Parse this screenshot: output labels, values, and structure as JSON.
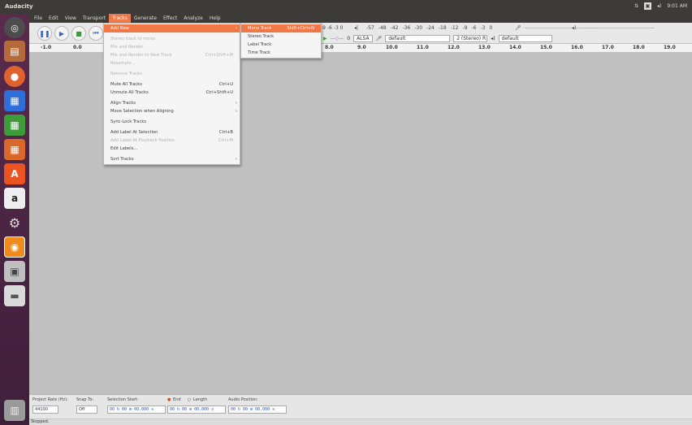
{
  "app": {
    "title": "Audacity"
  },
  "system": {
    "kbd": "⇅",
    "battery": "▣",
    "volume": "◂)",
    "clock": "9:01 AM"
  },
  "menubar": [
    "File",
    "Edit",
    "View",
    "Transport",
    "Tracks",
    "Generate",
    "Effect",
    "Analyze",
    "Help"
  ],
  "toolbar": {
    "meter_rec": "-9 -6 -3 0",
    "meter_ticks": [
      "-57",
      "-48",
      "-42",
      "-36",
      "-30",
      "-24",
      "-18",
      "-12",
      "-9",
      "-6",
      "-3",
      "0"
    ],
    "play_slider_label": "0",
    "host": "ALSA",
    "rec_device": "default",
    "channels": "2 (Stereo) R",
    "play_device": "default"
  },
  "ruler": [
    "-1.0",
    "0.0",
    "8.0",
    "9.0",
    "10.0",
    "11.0",
    "12.0",
    "13.0",
    "14.0",
    "15.0",
    "16.0",
    "17.0",
    "18.0",
    "19.0"
  ],
  "tracks_menu": [
    {
      "label": "Add New",
      "highlight": true,
      "submenu": true
    },
    {
      "sep": true
    },
    {
      "label": "Stereo track to mono",
      "disabled": true
    },
    {
      "label": "Mix and Render",
      "disabled": true
    },
    {
      "label": "Mix and Render to New Track",
      "shortcut": "Ctrl+Shift+M",
      "disabled": true
    },
    {
      "label": "Resample...",
      "disabled": true
    },
    {
      "sep": true
    },
    {
      "label": "Remove Tracks",
      "disabled": true
    },
    {
      "sep": true
    },
    {
      "label": "Mute All Tracks",
      "shortcut": "Ctrl+U"
    },
    {
      "label": "Unmute All Tracks",
      "shortcut": "Ctrl+Shift+U"
    },
    {
      "sep": true
    },
    {
      "label": "Align Tracks",
      "submenu": true
    },
    {
      "label": "Move Selection when Aligning",
      "submenu": true
    },
    {
      "sep": true
    },
    {
      "label": "Sync-Lock Tracks"
    },
    {
      "sep": true
    },
    {
      "label": "Add Label At Selection",
      "shortcut": "Ctrl+B"
    },
    {
      "label": "Add Label At Playback Position",
      "shortcut": "Ctrl+M",
      "disabled": true
    },
    {
      "label": "Edit Labels..."
    },
    {
      "sep": true
    },
    {
      "label": "Sort Tracks",
      "submenu": true
    }
  ],
  "add_new_submenu": [
    {
      "label": "Mono Track",
      "shortcut": "Shift+Ctrl+N",
      "highlight": true
    },
    {
      "label": "Stereo Track"
    },
    {
      "label": "Label Track"
    },
    {
      "label": "Time Track"
    }
  ],
  "bottom": {
    "rate_label": "Project Rate (Hz):",
    "rate_value": "44100",
    "snap_label": "Snap To:",
    "snap_value": "Off",
    "sel_start_label": "Selection Start:",
    "end_label": "End",
    "length_label": "Length",
    "audio_pos_label": "Audio Position:",
    "sel_start": "00 h 00 m 00.000 s",
    "sel_end": "00 h 00 m 00.000 s",
    "audio_pos": "00 h 00 m 00.000 s"
  },
  "status": "Stopped."
}
